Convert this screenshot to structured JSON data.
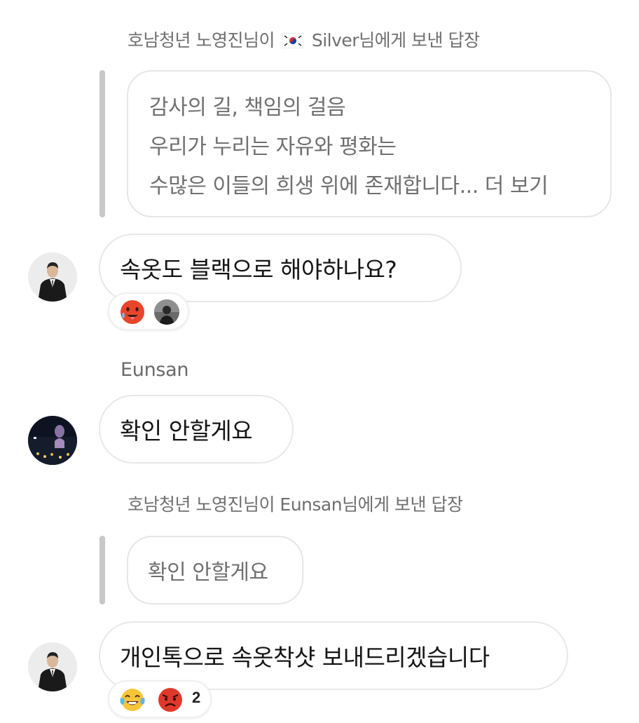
{
  "reply1": {
    "header_prefix": "호남청년 노영진님이",
    "header_suffix": "Silver님에게 보낸 답장",
    "quote_lines": [
      "감사의 길, 책임의 걸음",
      "우리가 누리는 자유와 평화는",
      "수많은 이들의 희생 위에 존재합니다... 더 보기"
    ]
  },
  "message1": {
    "text": "속옷도 블랙으로 해야하나요?",
    "reactions": [
      "hot-face-emoji",
      "user-avatar"
    ]
  },
  "message2": {
    "sender": "Eunsan",
    "text": "확인 안할게요"
  },
  "reply2": {
    "header": "호남청년 노영진님이 Eunsan님에게 보낸 답장",
    "quote_text": "확인 안할게요"
  },
  "message3": {
    "text": "개인톡으로 속옷착샷 보내드리겠습니다",
    "reactions": [
      "tears-of-joy-emoji",
      "angry-face-emoji"
    ],
    "reaction_count": "2"
  },
  "colors": {
    "bubble_border": "#e8e8e8",
    "quote_bar": "#c8c8c8",
    "muted_text": "#707070"
  }
}
